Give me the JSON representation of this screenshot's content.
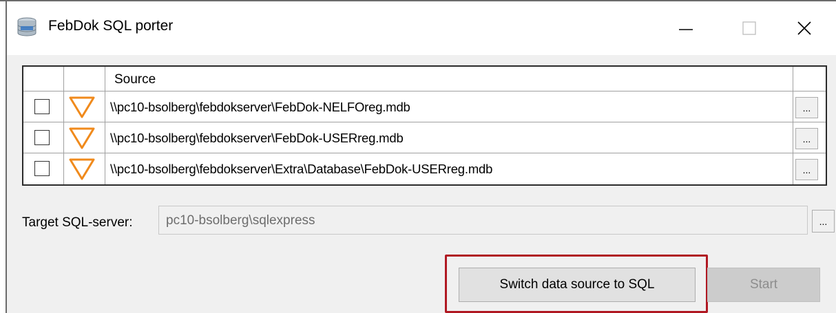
{
  "window": {
    "title": "FebDok SQL porter",
    "app_icon": "database-icon",
    "controls": [
      "minimize-icon",
      "maximize-icon",
      "close-icon"
    ]
  },
  "grid": {
    "columns": [
      "",
      "",
      "Source",
      ""
    ],
    "rows": [
      {
        "checked": false,
        "status_icon": "warning-triangle-icon",
        "source": "\\\\pc10-bsolberg\\febdokserver\\FebDok-NELFOreg.mdb",
        "browse_label": "..."
      },
      {
        "checked": false,
        "status_icon": "warning-triangle-icon",
        "source": "\\\\pc10-bsolberg\\febdokserver\\FebDok-USERreg.mdb",
        "browse_label": "..."
      },
      {
        "checked": false,
        "status_icon": "warning-triangle-icon",
        "source": "\\\\pc10-bsolberg\\febdokserver\\Extra\\Database\\FebDok-USERreg.mdb",
        "browse_label": "..."
      }
    ]
  },
  "target": {
    "label": "Target SQL-server:",
    "value": "pc10-bsolberg\\sqlexpress",
    "browse_label": "..."
  },
  "actions": {
    "switch_label": "Switch data source to SQL",
    "start_label": "Start",
    "start_enabled": false
  },
  "colors": {
    "highlight": "#b01822",
    "warning": "#f08a1c"
  }
}
